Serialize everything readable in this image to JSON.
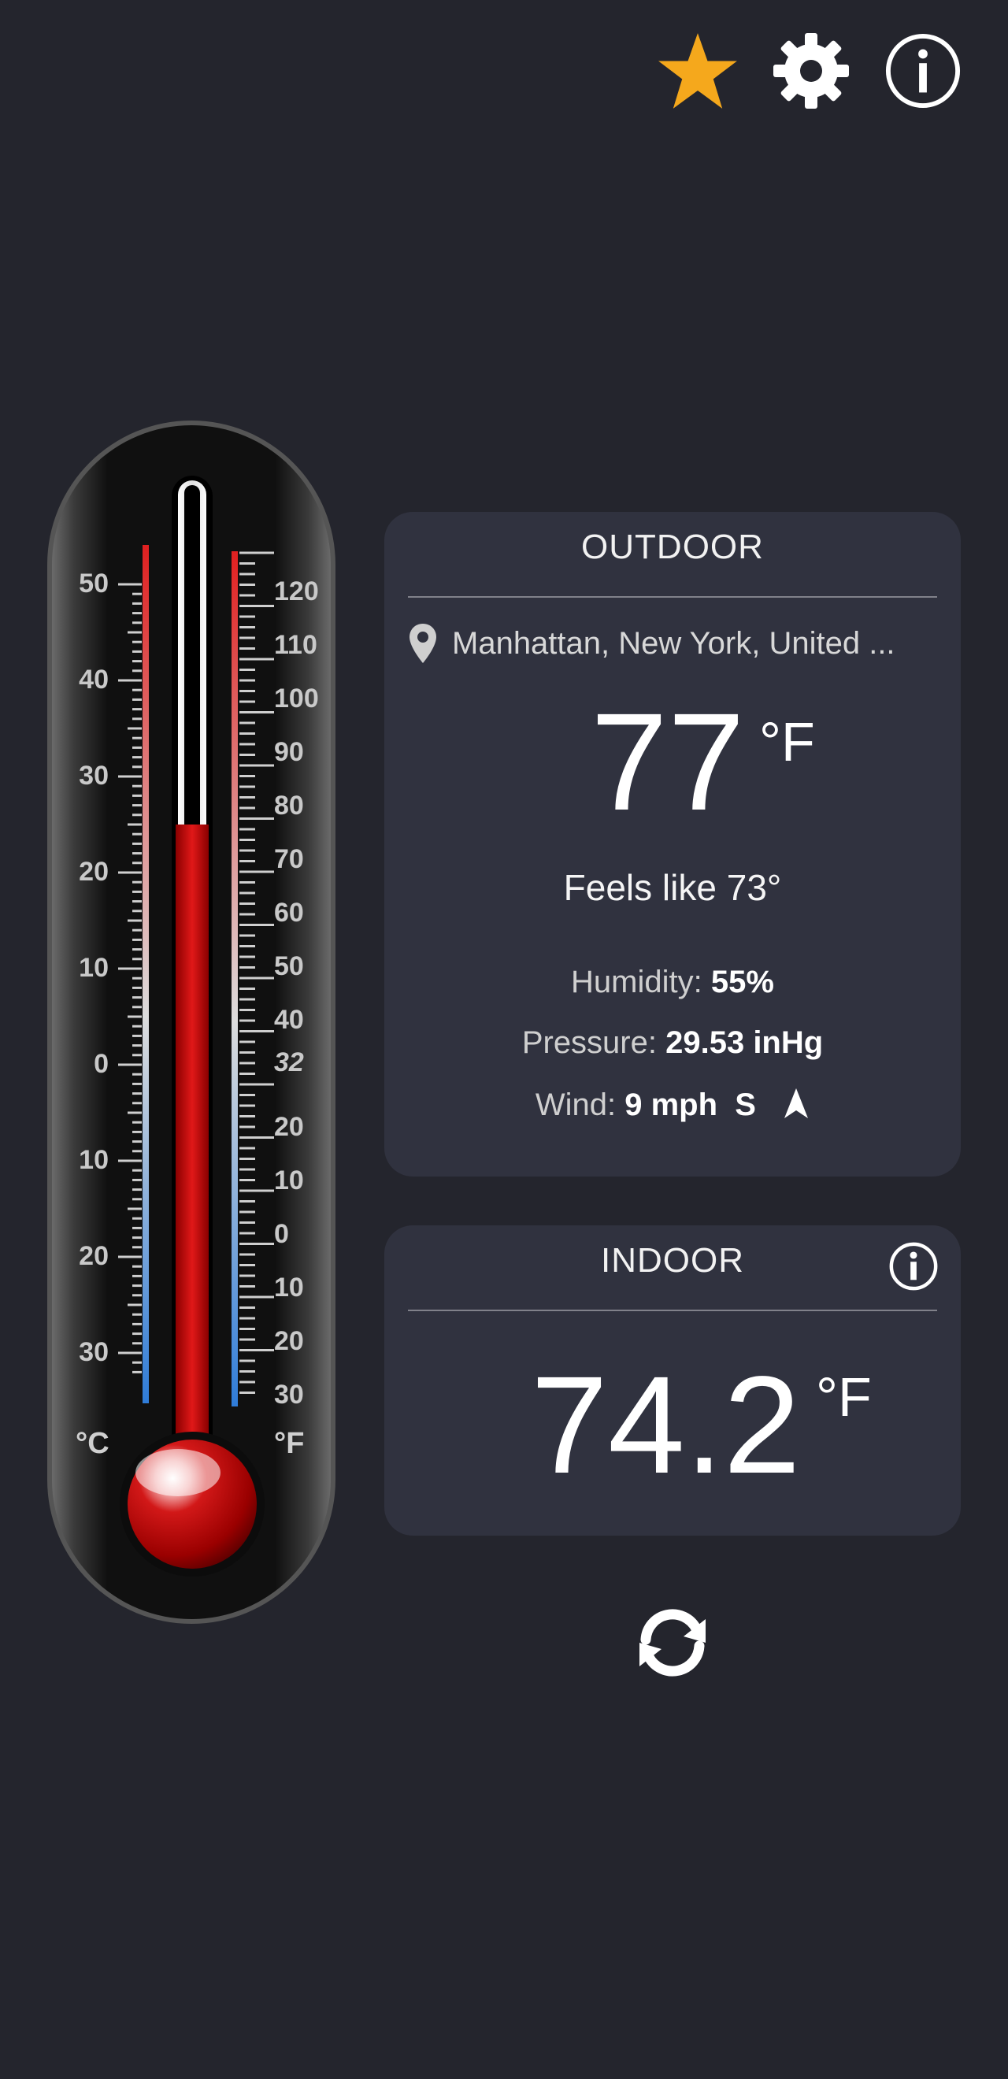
{
  "toolbar": {
    "star_icon": "star-icon",
    "settings_icon": "gear-icon",
    "info_icon": "info-icon",
    "star_color": "#f5a81c"
  },
  "thermometer": {
    "celsius_unit": "°C",
    "fahrenheit_unit": "°F",
    "celsius_labels": [
      "50",
      "40",
      "30",
      "20",
      "10",
      "0",
      "10",
      "20",
      "30"
    ],
    "fahrenheit_labels": [
      "120",
      "110",
      "100",
      "90",
      "80",
      "70",
      "60",
      "50",
      "40",
      "32",
      "20",
      "10",
      "0",
      "10",
      "20",
      "30"
    ],
    "reading_celsius": 25,
    "mercury_color": "#d01515"
  },
  "outdoor": {
    "title": "OUTDOOR",
    "location": "Manhattan, New York, United ...",
    "temperature": "77",
    "unit": "°F",
    "feels_like": "Feels like 73°",
    "humidity_label": "Humidity:",
    "humidity_value": "55%",
    "pressure_label": "Pressure:",
    "pressure_value": "29.53 inHg",
    "wind_label": "Wind:",
    "wind_value": "9 mph",
    "wind_direction": "S"
  },
  "indoor": {
    "title": "INDOOR",
    "temperature": "74.2",
    "unit": "°F"
  },
  "actions": {
    "refresh_icon": "refresh-icon"
  }
}
